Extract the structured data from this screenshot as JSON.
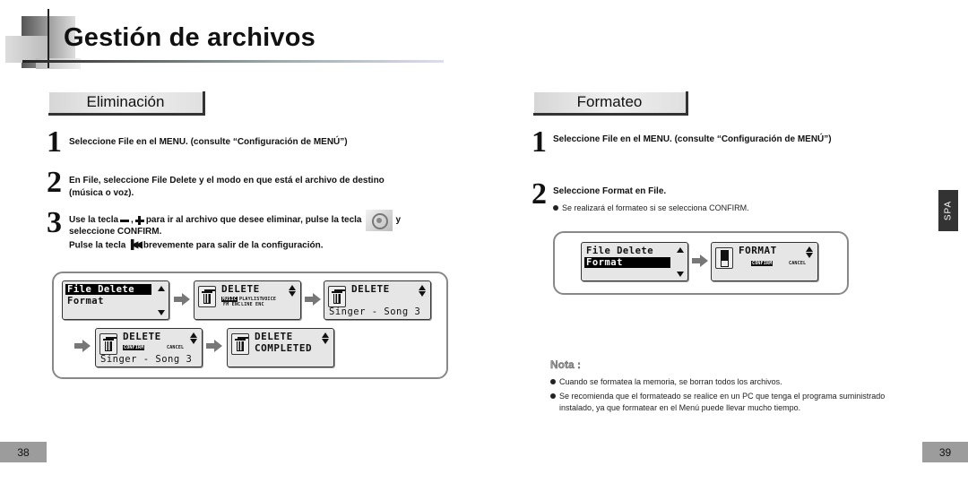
{
  "header": {
    "title": "Gestión de archivos"
  },
  "left": {
    "section_title": "Eliminación",
    "steps": [
      {
        "num": "1",
        "text": "Seleccione File en el MENU. (consulte “Configuración de MENÚ”)"
      },
      {
        "num": "2",
        "line1": "En File, seleccione File Delete y el modo en que está el archivo de destino",
        "line2": "(música o voz)."
      },
      {
        "num": "3",
        "part_a": "Use la tecla",
        "sep": ",",
        "part_b": "para ir al archivo que desee eliminar, pulse la tecla",
        "part_c": "y",
        "line2": "seleccione CONFIRM.",
        "line3_a": "Pulse la tecla",
        "line3_b": "brevemente para salir de la configuración."
      }
    ],
    "icons": {
      "minus": "minus-key-icon",
      "plus": "plus-key-icon",
      "jog": "jog-dial-icon",
      "prev": "skip-back-icon"
    },
    "screens": {
      "s1": {
        "row1": "File Delete",
        "row2": "Format"
      },
      "s2": {
        "title": "DELETE",
        "opt1": "MUSIC",
        "opt2": "PLAYLIST",
        "opt3": "VOICE",
        "opt4": "FM ENC",
        "opt5": "LINE ENC"
      },
      "s3": {
        "title": "DELETE",
        "sub": "Singer - Song 3"
      },
      "s4": {
        "title": "DELETE",
        "confirm": "CONFIRM",
        "cancel": "CANCEL",
        "sub": "Singer - Song 3"
      },
      "s5": {
        "title": "DELETE",
        "line2": "COMPLETED"
      }
    }
  },
  "right": {
    "section_title": "Formateo",
    "steps": [
      {
        "num": "1",
        "text": "Seleccione File en el MENU. (consulte “Configuración de MENÚ”)"
      },
      {
        "num": "2",
        "text": "Seleccione Format en File.",
        "bullet": "Se realizará el formateo si se selecciona CONFIRM."
      }
    ],
    "screens": {
      "s1": {
        "row1": "File Delete",
        "row2": "Format"
      },
      "s2": {
        "title": "FORMAT",
        "confirm": "CONFIRM",
        "cancel": "CANCEL"
      }
    },
    "nota": {
      "title": "Nota :",
      "items": [
        "Cuando se formatea la memoria, se borran todos los archivos.",
        "Se recomienda que el formateado se realice en un PC que tenga el programa suministrado",
        "instalado, ya que formatear en el Menú puede llevar mucho tiempo."
      ]
    }
  },
  "side_tab": "SPA",
  "pages": {
    "left": "38",
    "right": "39"
  }
}
